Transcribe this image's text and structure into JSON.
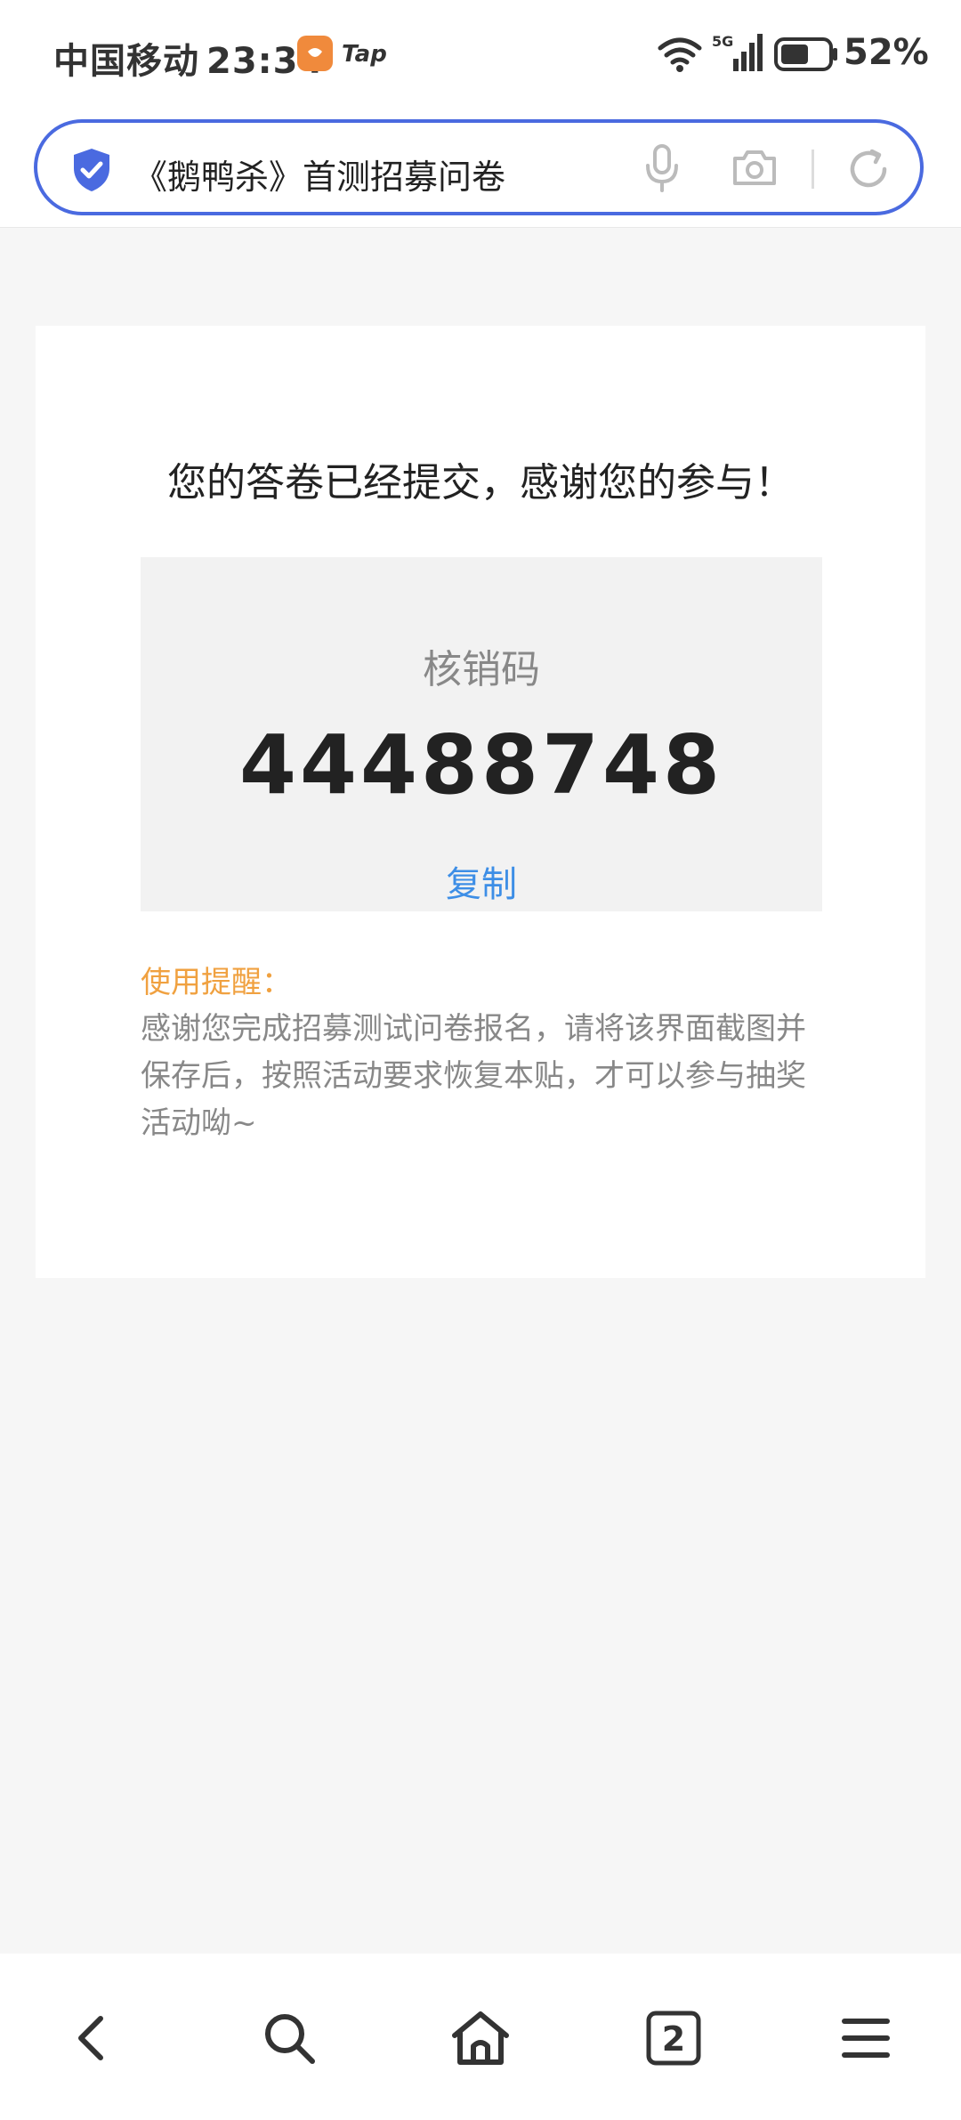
{
  "status_bar": {
    "carrier": "中国移动",
    "time": "23:34",
    "app_badge": "Tap",
    "network": "5G",
    "battery": "52%"
  },
  "address_bar": {
    "title": "《鹅鸭杀》首测招募问卷",
    "accent_color": "#4a6ae0"
  },
  "result": {
    "message": "您的答卷已经提交，感谢您的参与！",
    "code_label": "核销码",
    "code_value": "44488748",
    "copy_label": "复制"
  },
  "tips": {
    "title": "使用提醒：",
    "body": "感谢您完成招募测试问卷报名，请将该界面截图并保存后，按照活动要求恢复本贴，才可以参与抽奖活动呦~"
  },
  "bottom_nav": {
    "tab_count": "2"
  },
  "icons": [
    "shield-check-icon",
    "mic-icon",
    "camera-icon",
    "reload-icon",
    "back-icon",
    "search-icon",
    "home-icon",
    "tabs-icon",
    "menu-icon"
  ]
}
